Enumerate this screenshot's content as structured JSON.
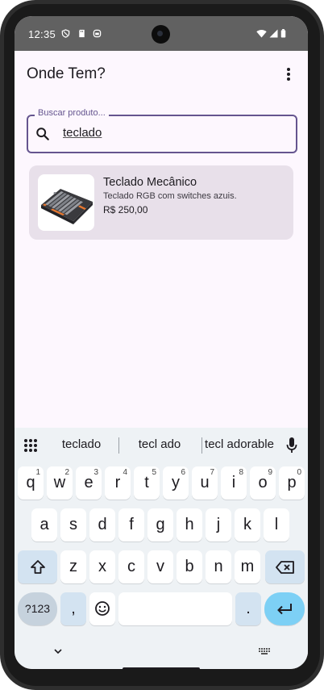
{
  "status_bar": {
    "time": "12:35",
    "left_icons": [
      "shield-icon",
      "sd-card-icon",
      "android-icon"
    ],
    "right_icons": [
      "wifi-icon",
      "signal-icon",
      "battery-icon"
    ]
  },
  "app": {
    "title": "Onde Tem?",
    "menu_icon": "more-vert-icon"
  },
  "search": {
    "label": "Buscar produto...",
    "value": "teclado",
    "icon": "search-icon"
  },
  "results": [
    {
      "name": "Teclado Mecânico",
      "description": "Teclado RGB com switches azuis.",
      "price": "R$ 250,00"
    }
  ],
  "keyboard": {
    "suggestions": [
      "teclado",
      "tecl ado",
      "tecl adorable"
    ],
    "row1": [
      "q",
      "w",
      "e",
      "r",
      "t",
      "y",
      "u",
      "i",
      "o",
      "p"
    ],
    "row1_hints": [
      "1",
      "2",
      "3",
      "4",
      "5",
      "6",
      "7",
      "8",
      "9",
      "0"
    ],
    "row2": [
      "a",
      "s",
      "d",
      "f",
      "g",
      "h",
      "j",
      "k",
      "l"
    ],
    "row3": [
      "z",
      "x",
      "c",
      "v",
      "b",
      "n",
      "m"
    ],
    "symbols_label": "?123",
    "comma_label": ",",
    "period_label": "."
  },
  "colors": {
    "primary": "#65558f",
    "card": "#e8e0ea",
    "background": "#fdf7fe",
    "status_bar": "#616161",
    "enter_key": "#7dd0f5"
  }
}
